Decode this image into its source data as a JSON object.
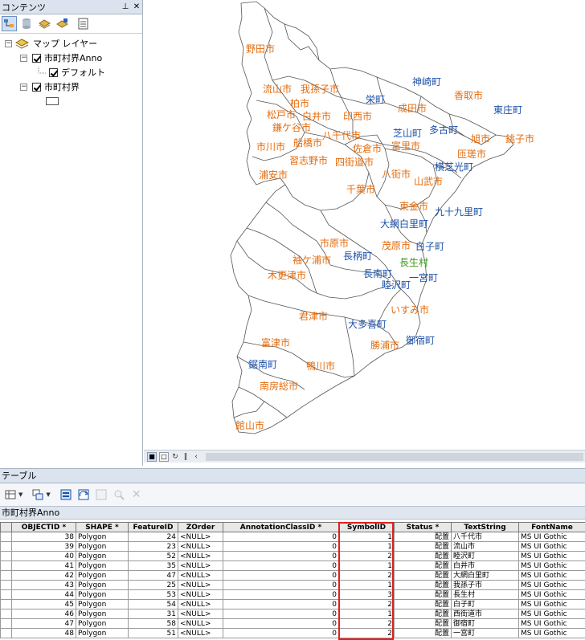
{
  "toc": {
    "title": "コンテンツ",
    "pin_icon": "pin-icon",
    "close_icon": "close-icon",
    "layers": {
      "root": "マップ レイヤー",
      "anno": "市町村界Anno",
      "anno_class": "デフォルト",
      "poly": "市町村界"
    }
  },
  "map": {
    "labels_orange": [
      "野田市",
      "流山市",
      "我孫子市",
      "柏市",
      "松戸市",
      "白井市",
      "印西市",
      "成田市",
      "香取市",
      "鎌ケ谷市",
      "八千代市",
      "旭市",
      "銚子市",
      "市川市",
      "船橋市",
      "佐倉市",
      "富里市",
      "匝瑳市",
      "習志野市",
      "四街道市",
      "浦安市",
      "八街市",
      "山武市",
      "千葉市",
      "東金市",
      "市原市",
      "袖ケ浦市",
      "木更津市",
      "茂原市",
      "君津市",
      "いすみ市",
      "富津市",
      "勝浦市",
      "鴨川市",
      "南房総市",
      "館山市"
    ],
    "labels_blue": [
      "神崎町",
      "栄町",
      "東庄町",
      "芝山町",
      "多古町",
      "横芝光町",
      "九十九里町",
      "大網白里町",
      "白子町",
      "長柄町",
      "長南町",
      "一宮町",
      "睦沢町",
      "大多喜町",
      "御宿町",
      "鋸南町"
    ],
    "labels_green": [
      "長生村"
    ]
  },
  "table_window": {
    "title": "テーブル",
    "tab_name": "市町村界Anno"
  },
  "grid": {
    "columns": [
      "OBJECTID *",
      "SHAPE *",
      "FeatureID",
      "ZOrder",
      "AnnotationClassID *",
      "SymbolID",
      "Status *",
      "TextString",
      "FontName"
    ],
    "rows": [
      [
        "38",
        "Polygon",
        "24",
        "<NULL>",
        "0",
        "1",
        "配置",
        "八千代市",
        "MS UI Gothic"
      ],
      [
        "39",
        "Polygon",
        "23",
        "<NULL>",
        "0",
        "1",
        "配置",
        "流山市",
        "MS UI Gothic"
      ],
      [
        "40",
        "Polygon",
        "52",
        "<NULL>",
        "0",
        "2",
        "配置",
        "睦沢町",
        "MS UI Gothic"
      ],
      [
        "41",
        "Polygon",
        "35",
        "<NULL>",
        "0",
        "1",
        "配置",
        "白井市",
        "MS UI Gothic"
      ],
      [
        "42",
        "Polygon",
        "47",
        "<NULL>",
        "0",
        "2",
        "配置",
        "大網白里町",
        "MS UI Gothic"
      ],
      [
        "43",
        "Polygon",
        "25",
        "<NULL>",
        "0",
        "1",
        "配置",
        "我孫子市",
        "MS UI Gothic"
      ],
      [
        "44",
        "Polygon",
        "53",
        "<NULL>",
        "0",
        "3",
        "配置",
        "長生村",
        "MS UI Gothic"
      ],
      [
        "45",
        "Polygon",
        "54",
        "<NULL>",
        "0",
        "2",
        "配置",
        "白子町",
        "MS UI Gothic"
      ],
      [
        "46",
        "Polygon",
        "31",
        "<NULL>",
        "0",
        "1",
        "配置",
        "西街道市",
        "MS UI Gothic"
      ],
      [
        "47",
        "Polygon",
        "58",
        "<NULL>",
        "0",
        "2",
        "配置",
        "御宿町",
        "MS UI Gothic"
      ],
      [
        "48",
        "Polygon",
        "51",
        "<NULL>",
        "0",
        "2",
        "配置",
        "一宮町",
        "MS UI Gothic"
      ]
    ]
  },
  "colors": {
    "city_label": "#e46b0d",
    "town_label": "#1a4fa8",
    "village_label": "#3a9a1a",
    "highlight": "#e02020"
  }
}
